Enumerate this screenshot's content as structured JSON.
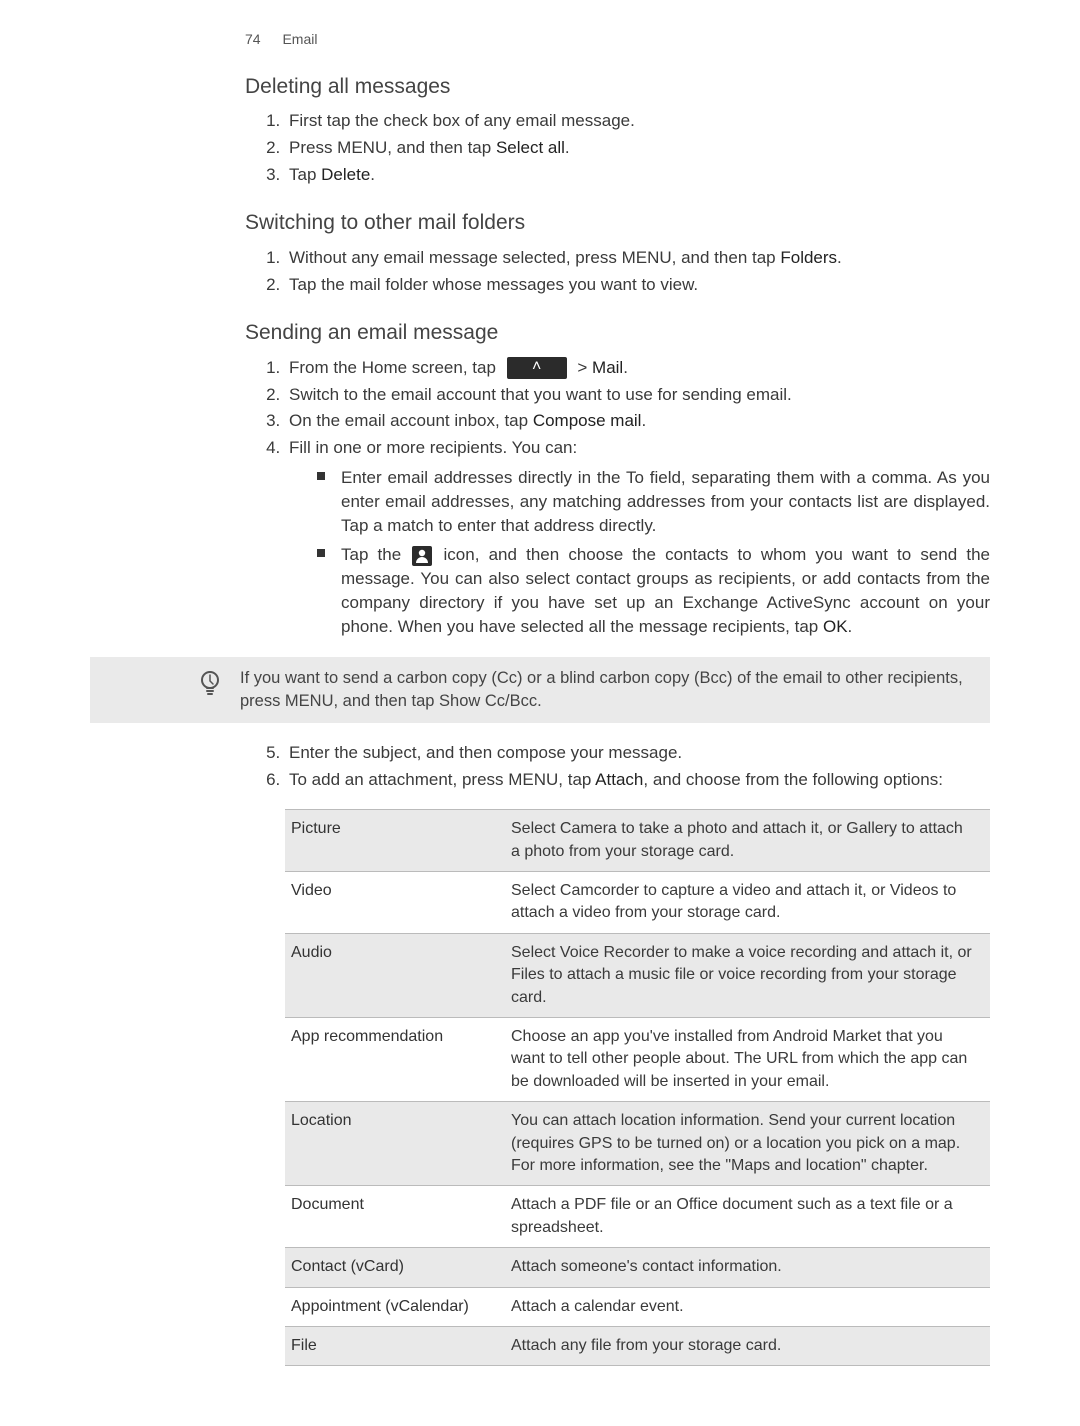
{
  "header": {
    "page_number": "74",
    "section": "Email"
  },
  "sections": {
    "deleting": {
      "title": "Deleting all messages",
      "steps": {
        "s1": "First tap the check box of any email message.",
        "s2a": "Press MENU, and then tap ",
        "s2b": "Select all",
        "s2c": ".",
        "s3a": "Tap ",
        "s3b": "Delete",
        "s3c": "."
      }
    },
    "switching": {
      "title": "Switching to other mail folders",
      "steps": {
        "s1a": "Without any email message selected, press MENU, and then tap ",
        "s1b": "Folders",
        "s1c": ".",
        "s2": "Tap the mail folder whose messages you want to view."
      }
    },
    "sending": {
      "title": "Sending an email message",
      "steps": {
        "s1a": "From the Home screen, tap ",
        "s1b": " > ",
        "s1c": "Mail",
        "s1d": ".",
        "s2": "Switch to the email account that you want to use for sending email.",
        "s3a": "On the email account inbox, tap ",
        "s3b": "Compose mail",
        "s3c": ".",
        "s4": "Fill in one or more recipients. You can:",
        "b1": "Enter email addresses directly in the To field, separating them with a comma. As you enter email addresses, any matching addresses from your contacts list are displayed. Tap a match to enter that address directly.",
        "b2a": "Tap the ",
        "b2b": " icon, and then choose the contacts to whom you want to send the message. You can also select contact groups as recipients, or add contacts from the company directory if you have set up an Exchange ActiveSync account on your phone. When you have selected all the message recipients, tap ",
        "b2c": "OK",
        "b2d": ".",
        "tip_a": "If you want to send a carbon copy (Cc) or a blind carbon copy (Bcc) of the email to other recipients, press MENU, and then tap ",
        "tip_b": "Show Cc/Bcc",
        "tip_c": ".",
        "s5": "Enter the subject, and then compose your message.",
        "s6a": "To add an attachment, press MENU, tap ",
        "s6b": "Attach",
        "s6c": ", and choose from the following options:"
      },
      "attach_table": {
        "r1k": "Picture",
        "r1v": "Select Camera to take a photo and attach it, or Gallery to attach a photo from your storage card.",
        "r2k": "Video",
        "r2v": "Select Camcorder to capture a video and attach it, or Videos to attach a video from your storage card.",
        "r3k": "Audio",
        "r3v": "Select Voice Recorder to make a voice recording and attach it, or Files to attach a music file or voice recording from your storage card.",
        "r4k": "App recommendation",
        "r4v": "Choose an app you've installed from Android Market that you want to tell other people about. The URL from which the app can be downloaded will be inserted in your email.",
        "r5k": "Location",
        "r5v": "You can attach location information. Send your current location (requires GPS to be turned on) or a location you pick on a map. For more information, see the \"Maps and location\" chapter.",
        "r6k": "Document",
        "r6v": "Attach a PDF file or an Office document such as a text file or a spreadsheet.",
        "r7k": "Contact (vCard)",
        "r7v": "Attach someone's contact information.",
        "r8k": "Appointment (vCalendar)",
        "r8v": "Attach a calendar event.",
        "r9k": "File",
        "r9v": "Attach any file from your storage card."
      }
    }
  },
  "icons": {
    "chevron_glyph": "˄"
  }
}
